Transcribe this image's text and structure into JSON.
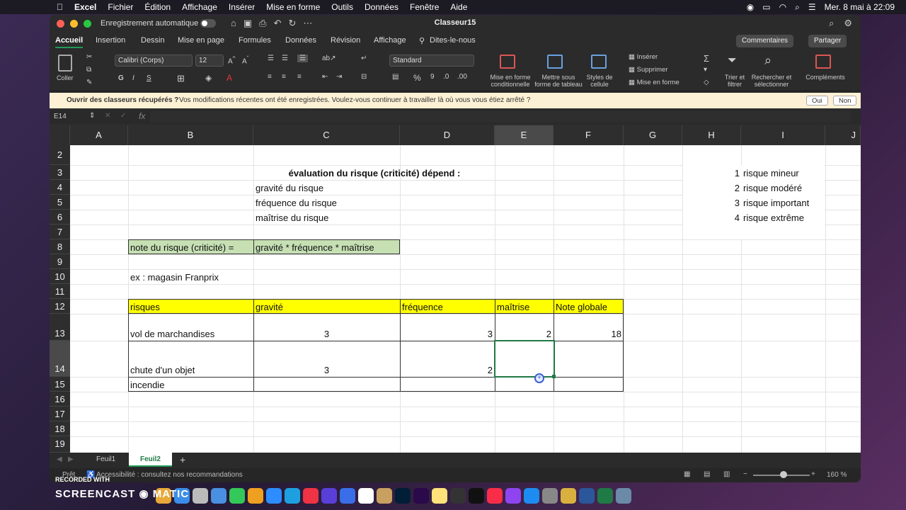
{
  "menubar": {
    "apple": "",
    "app": "Excel",
    "items": [
      "Fichier",
      "Édition",
      "Affichage",
      "Insérer",
      "Mise en forme",
      "Outils",
      "Données",
      "Fenêtre",
      "Aide"
    ],
    "datetime": "Mer. 8 mai à 22:09"
  },
  "titlebar": {
    "autosave": "Enregistrement automatique",
    "toggle": "○",
    "doc": "Classeur15"
  },
  "tabs": [
    "Accueil",
    "Insertion",
    "Dessin",
    "Mise en page",
    "Formules",
    "Données",
    "Révision",
    "Affichage",
    "Dites-le-nous"
  ],
  "buttons": {
    "comments": "Commentaires",
    "share": "Partager"
  },
  "ribbon": {
    "paste": "Coller",
    "font": "Calibri (Corps)",
    "size": "12",
    "format": "Standard",
    "cond": "Mise en forme conditionnelle",
    "table": "Mettre sous forme de tableau",
    "styles": "Styles de cellule",
    "insert": "Insérer",
    "delete": "Supprimer",
    "format2": "Mise en forme",
    "sort": "Trier et filtrer",
    "find": "Rechercher et sélectionner",
    "addins": "Compléments",
    "bold": "G",
    "italic": "I",
    "underline": "S",
    "pct": "%",
    "comma": "9"
  },
  "notif": {
    "title": "Ouvrir des classeurs récupérés ?",
    "msg": "Vos modifications récentes ont été enregistrées. Voulez-vous continuer à travailler là où vous vous étiez arrêté ?",
    "yes": "Oui",
    "no": "Non"
  },
  "formula": {
    "name": "E14",
    "fx": "fx"
  },
  "columns": [
    "A",
    "B",
    "C",
    "D",
    "E",
    "F",
    "G",
    "H",
    "I",
    "J"
  ],
  "rows": [
    "2",
    "3",
    "4",
    "5",
    "6",
    "7",
    "8",
    "9",
    "10",
    "11",
    "12",
    "13",
    "14",
    "15",
    "16",
    "17",
    "18",
    "19"
  ],
  "cells": {
    "c3": "évaluation du risque (criticité) dépend :",
    "c4": "gravité du risque",
    "c5": "fréquence du risque",
    "c6": "maîtrise du risque",
    "b8": "note du risque (criticité) =",
    "c8": "gravité * fréquence * maîtrise",
    "b10": "ex : magasin Franprix",
    "b12": "risques",
    "c12": "gravité",
    "d12": "fréquence",
    "e12": "maîtrise",
    "f12": "Note globale",
    "b13": "vol de marchandises",
    "c13": "3",
    "d13": "3",
    "e13": "2",
    "f13": "18",
    "b14": "chute d'un objet",
    "c14": "3",
    "d14": "2",
    "b15": "incendie",
    "h3": "1",
    "h4": "2",
    "h5": "3",
    "h6": "4",
    "i3": "risque mineur",
    "i4": "risque modéré",
    "i5": "risque important",
    "i6": "risque extrême"
  },
  "sheets": [
    "Feuil1",
    "Feuil2",
    "+"
  ],
  "status": {
    "ready": "Prêt",
    "access": "Accessibilité : consultez nos recommandations",
    "zoom": "160 %"
  },
  "recorder": {
    "line1": "RECORDED WITH",
    "line2a": "SCREENCAST",
    "line2b": "MATIC"
  },
  "colors": {
    "yellow": "#ffff00",
    "green": "#c6e0b4",
    "accent": "#1f9a55"
  }
}
